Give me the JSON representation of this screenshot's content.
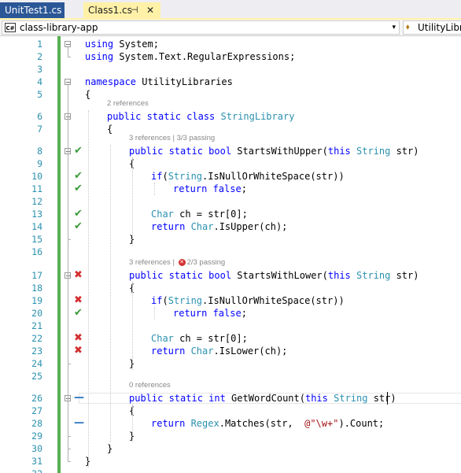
{
  "tabs": [
    {
      "label": "UnitTest1.cs",
      "active": false
    },
    {
      "label": "Class1.cs",
      "active": true,
      "pin": "⊣",
      "close": "✕"
    }
  ],
  "navbar": {
    "project_icon": "C#",
    "project": "class-library-app",
    "dropdown": "▾",
    "member_icon": "class-icon",
    "member": "UtilityLibra"
  },
  "colors": {
    "pass": "#3a9a3a",
    "fail": "#d32f2f",
    "not_run": "#1e6fbf",
    "changed_bar": "#58b052"
  },
  "code_lines": [
    {
      "num": "1",
      "status": "",
      "segments": [
        [
          "kw",
          "using"
        ],
        [
          "",
          "System;"
        ]
      ]
    },
    {
      "num": "2",
      "status": "",
      "segments": [
        [
          "kw",
          "using"
        ],
        [
          "",
          "System.Text.RegularExpressions;"
        ]
      ]
    },
    {
      "num": "3",
      "status": "",
      "segments": []
    },
    {
      "num": "4",
      "status": "",
      "segments": [
        [
          "kw",
          "namespace"
        ],
        [
          "",
          "UtilityLibraries"
        ]
      ]
    },
    {
      "num": "5",
      "status": "",
      "segments": [
        [
          "",
          "{"
        ]
      ]
    },
    {
      "num": "6",
      "status": "",
      "segments": [
        [
          "kw",
          "public static class"
        ],
        [
          "ty",
          "StringLibrary"
        ]
      ]
    },
    {
      "num": "7",
      "status": "",
      "segments": [
        [
          "",
          "{"
        ]
      ]
    },
    {
      "num": "8",
      "status": "pass",
      "segments": [
        [
          "kw",
          "public static bool"
        ],
        [
          "",
          "StartsWithUpper("
        ],
        [
          "kw",
          "this"
        ],
        [
          "ty",
          "String"
        ],
        [
          "",
          "str)"
        ]
      ]
    },
    {
      "num": "9",
      "status": "",
      "segments": [
        [
          "",
          "{"
        ]
      ]
    },
    {
      "num": "10",
      "status": "pass",
      "segments": [
        [
          "kw",
          "if"
        ],
        [
          "",
          "("
        ],
        [
          "ty",
          "String"
        ],
        [
          "",
          ".IsNullOrWhiteSpace(str))"
        ]
      ]
    },
    {
      "num": "11",
      "status": "pass",
      "segments": [
        [
          "kw",
          "return false"
        ],
        [
          "",
          ";"
        ]
      ]
    },
    {
      "num": "12",
      "status": "",
      "segments": []
    },
    {
      "num": "13",
      "status": "pass",
      "segments": [
        [
          "ty",
          "Char"
        ],
        [
          "",
          "ch = str[0];"
        ]
      ]
    },
    {
      "num": "14",
      "status": "pass",
      "segments": [
        [
          "kw",
          "return"
        ],
        [
          "ty",
          "Char"
        ],
        [
          "",
          ".IsUpper(ch);"
        ]
      ]
    },
    {
      "num": "15",
      "status": "",
      "segments": [
        [
          "",
          "}"
        ]
      ]
    },
    {
      "num": "16",
      "status": "",
      "segments": []
    },
    {
      "num": "17",
      "status": "fail",
      "segments": [
        [
          "kw",
          "public static bool"
        ],
        [
          "",
          "StartsWithLower("
        ],
        [
          "kw",
          "this"
        ],
        [
          "ty",
          "String"
        ],
        [
          "",
          "str)"
        ]
      ]
    },
    {
      "num": "18",
      "status": "",
      "segments": [
        [
          "",
          "{"
        ]
      ]
    },
    {
      "num": "19",
      "status": "fail",
      "segments": [
        [
          "kw",
          "if"
        ],
        [
          "",
          "("
        ],
        [
          "ty",
          "String"
        ],
        [
          "",
          ".IsNullOrWhiteSpace(str))"
        ]
      ]
    },
    {
      "num": "20",
      "status": "pass",
      "segments": [
        [
          "kw",
          "return false"
        ],
        [
          "",
          ";"
        ]
      ]
    },
    {
      "num": "21",
      "status": "",
      "segments": []
    },
    {
      "num": "22",
      "status": "fail",
      "segments": [
        [
          "ty",
          "Char"
        ],
        [
          "",
          "ch = str[0];"
        ]
      ]
    },
    {
      "num": "23",
      "status": "fail",
      "segments": [
        [
          "kw",
          "return"
        ],
        [
          "ty",
          "Char"
        ],
        [
          "",
          ".IsLower(ch);"
        ]
      ]
    },
    {
      "num": "24",
      "status": "",
      "segments": [
        [
          "",
          "}"
        ]
      ]
    },
    {
      "num": "25",
      "status": "",
      "segments": []
    },
    {
      "num": "26",
      "status": "none",
      "segments": [
        [
          "kw",
          "public static int"
        ],
        [
          "",
          "GetWordCount("
        ],
        [
          "kw",
          "this"
        ],
        [
          "ty",
          "String"
        ],
        [
          "",
          "str)"
        ]
      ]
    },
    {
      "num": "27",
      "status": "",
      "segments": [
        [
          "",
          "{"
        ]
      ]
    },
    {
      "num": "28",
      "status": "none",
      "segments": [
        [
          "kw",
          "return"
        ],
        [
          "ty",
          "Regex"
        ],
        [
          "",
          ".Matches(str, "
        ],
        [
          "st",
          "@\"\\w+\""
        ],
        [
          "",
          ").Count;"
        ]
      ]
    },
    {
      "num": "29",
      "status": "",
      "segments": [
        [
          "",
          "}"
        ]
      ]
    },
    {
      "num": "30",
      "status": "",
      "segments": [
        [
          "",
          "}"
        ]
      ]
    },
    {
      "num": "31",
      "status": "",
      "segments": [
        [
          "",
          "}"
        ]
      ]
    },
    {
      "num": "32",
      "status": "",
      "segments": []
    }
  ],
  "codelens": [
    {
      "before_line": "6",
      "text": "2 references"
    },
    {
      "before_line": "8",
      "text": "3 references | ",
      "icon": "check-icon",
      "tests": "3/3 passing"
    },
    {
      "before_line": "17",
      "text": "3 references | ",
      "icon": "fail-icon",
      "tests": "2/3 passing"
    },
    {
      "before_line": "26",
      "text": "0 references"
    }
  ],
  "status_glyphs": {
    "pass": "✔",
    "fail": "✖",
    "none": "—"
  }
}
